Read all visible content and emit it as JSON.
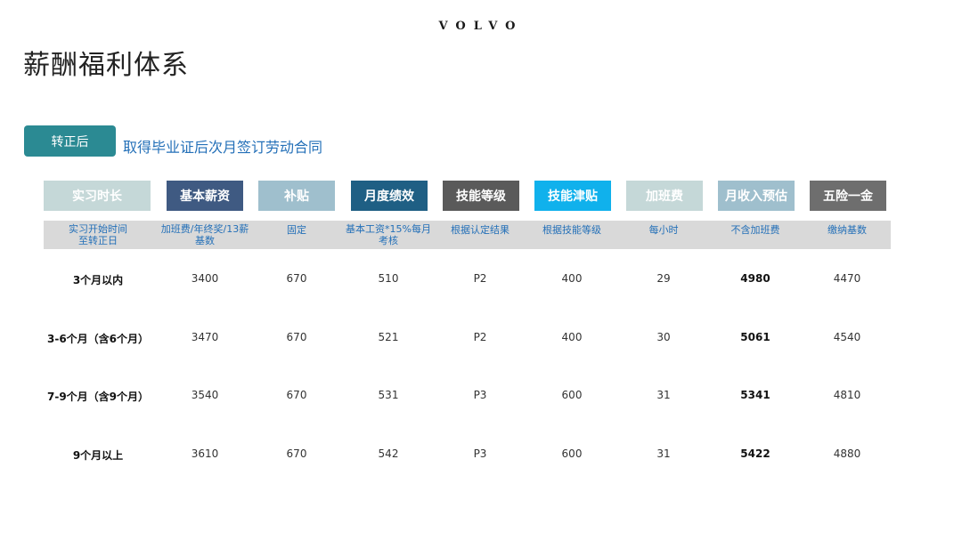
{
  "logo": "VOLVO",
  "title": "薪酬福利体系",
  "badge": "转正后",
  "note": "取得毕业证后次月签订劳动合同",
  "headers": [
    {
      "label": "实习时长",
      "color": "#c5d8d8"
    },
    {
      "label": "基本薪资",
      "color": "#3f5a82"
    },
    {
      "label": "补贴",
      "color": "#9fbfcd"
    },
    {
      "label": "月度绩效",
      "color": "#1f5f84"
    },
    {
      "label": "技能等级",
      "color": "#5a5a5a"
    },
    {
      "label": "技能津贴",
      "color": "#10b1ec"
    },
    {
      "label": "加班费",
      "color": "#c5d8d8"
    },
    {
      "label": "月收入预估",
      "color": "#9fbfcd"
    },
    {
      "label": "五险一金",
      "color": "#6e6e6e"
    }
  ],
  "subheaders": [
    "实习开始时间\n至转正日",
    "加班费/年终奖/13薪\n基数",
    "固定",
    "基本工资*15%每月\n考核",
    "根据认定结果",
    "根据技能等级",
    "每小时",
    "不含加班费",
    "缴纳基数"
  ],
  "rows": [
    [
      "3个月以内",
      "3400",
      "670",
      "510",
      "P2",
      "400",
      "29",
      "4980",
      "4470"
    ],
    [
      "3-6个月（含6个月）",
      "3470",
      "670",
      "521",
      "P2",
      "400",
      "30",
      "5061",
      "4540"
    ],
    [
      "7-9个月（含9个月）",
      "3540",
      "670",
      "531",
      "P3",
      "600",
      "31",
      "5341",
      "4810"
    ],
    [
      "9个月以上",
      "3610",
      "670",
      "542",
      "P3",
      "600",
      "31",
      "5422",
      "4880"
    ]
  ]
}
